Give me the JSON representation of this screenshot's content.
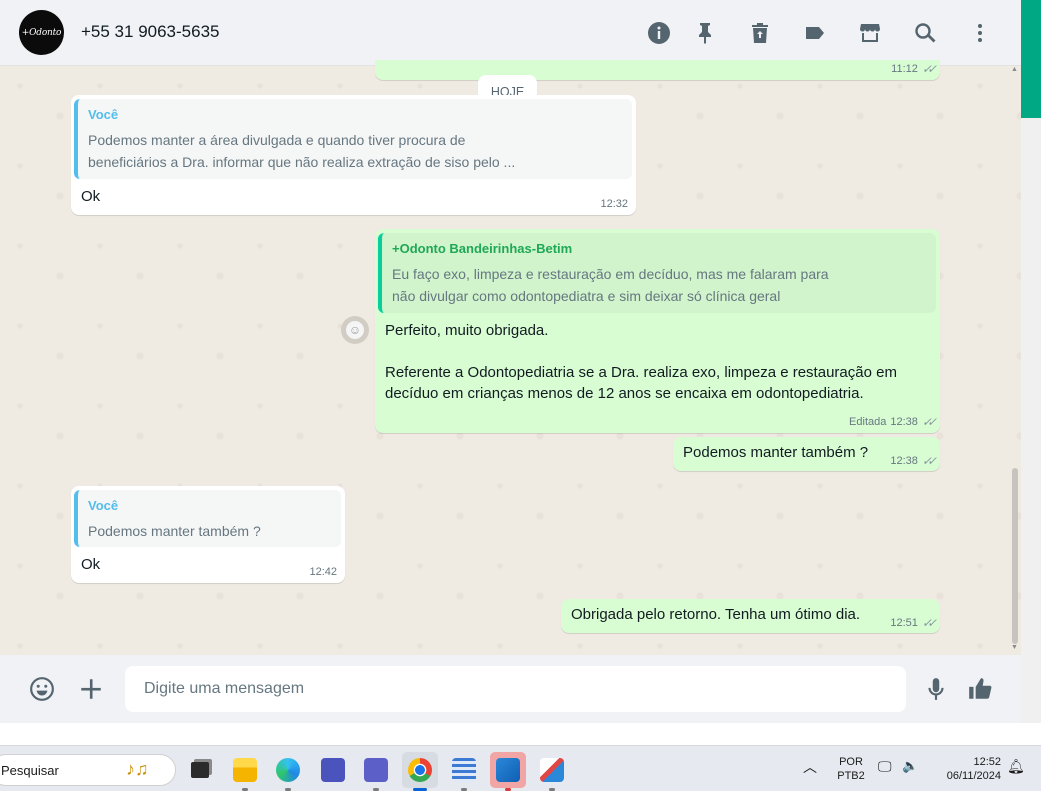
{
  "header": {
    "avatar_text": "+Odonto",
    "contact": "+55 31 9063-5635",
    "icons": [
      "info-icon",
      "pin-icon",
      "delete-icon",
      "label-icon",
      "store-icon",
      "search-icon",
      "more-vertical-icon"
    ]
  },
  "chat": {
    "date_chip": "HOJE",
    "prev_time": "11:12",
    "messages": [
      {
        "direction": "in",
        "quote_author": "Você",
        "quote_text": "Podemos manter a área divulgada e quando tiver procura de\nbeneficiários a Dra. informar que não realiza extração de siso pelo ...",
        "text": "Ok",
        "time": "12:32"
      },
      {
        "direction": "out",
        "quote_author": "+Odonto Bandeirinhas-Betim",
        "quote_text": "Eu faço exo, limpeza e restauração em decíduo, mas me falaram para\nnão divulgar como odontopediatra e sim deixar só clínica geral",
        "text": "Perfeito, muito obrigada.\n\nReferente a Odontopediatria se a Dra. realiza exo, limpeza e restauração em\ndecíduo em crianças menos de 12 anos se encaixa em odontopediatria.",
        "edited": "Editada",
        "time": "12:38"
      },
      {
        "direction": "out",
        "text": "Podemos manter também ?",
        "time": "12:38"
      },
      {
        "direction": "in",
        "quote_author": "Você",
        "quote_text": "Podemos manter também ?",
        "text": "Ok",
        "time": "12:42"
      },
      {
        "direction": "out",
        "text": "Obrigada pelo retorno. Tenha um ótimo dia.",
        "time": "12:51"
      }
    ]
  },
  "composer": {
    "placeholder": "Digite uma mensagem",
    "icons": [
      "emoji-icon",
      "plus-icon",
      "microphone-icon",
      "thumbs-up-icon"
    ]
  },
  "taskbar": {
    "search_text": "Pesquisar",
    "apps": [
      "task-view",
      "file-explorer",
      "edge",
      "teams-work",
      "teams",
      "chrome",
      "notepad",
      "photos",
      "snipping-tool"
    ],
    "lang_top": "POR",
    "lang_bottom": "PTB2",
    "time": "12:52",
    "date": "06/11/2024"
  },
  "colors": {
    "accent": "#00a884",
    "outgoing": "#d9fdd3",
    "chat_bg": "#efeae2",
    "quote_in_bar": "#53bdeb",
    "quote_out_bar": "#06cf9c"
  }
}
